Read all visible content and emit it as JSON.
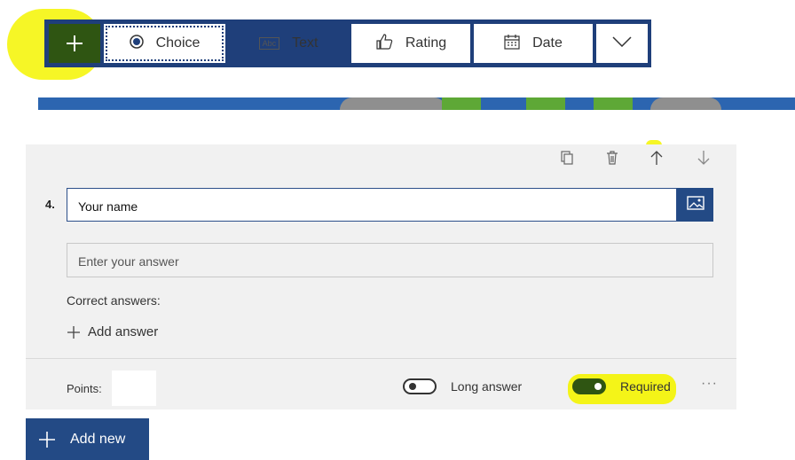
{
  "toolbar": {
    "choice_label": "Choice",
    "text_label": "Text",
    "rating_label": "Rating",
    "date_label": "Date",
    "text_icon_label": "Abc"
  },
  "question": {
    "number": "4.",
    "title": "Your name",
    "answer_placeholder": "Enter your answer",
    "correct_answers_label": "Correct answers:",
    "add_answer_label": "Add answer",
    "points_label": "Points:",
    "long_answer_label": "Long answer",
    "long_answer_on": false,
    "required_label": "Required",
    "required_on": true,
    "more_label": "···"
  },
  "add_new_label": "Add new",
  "colors": {
    "accent": "#234a85",
    "toolbar_border": "#1f3f7a",
    "toggle_on": "#2f5512",
    "highlight": "#f4f400"
  }
}
